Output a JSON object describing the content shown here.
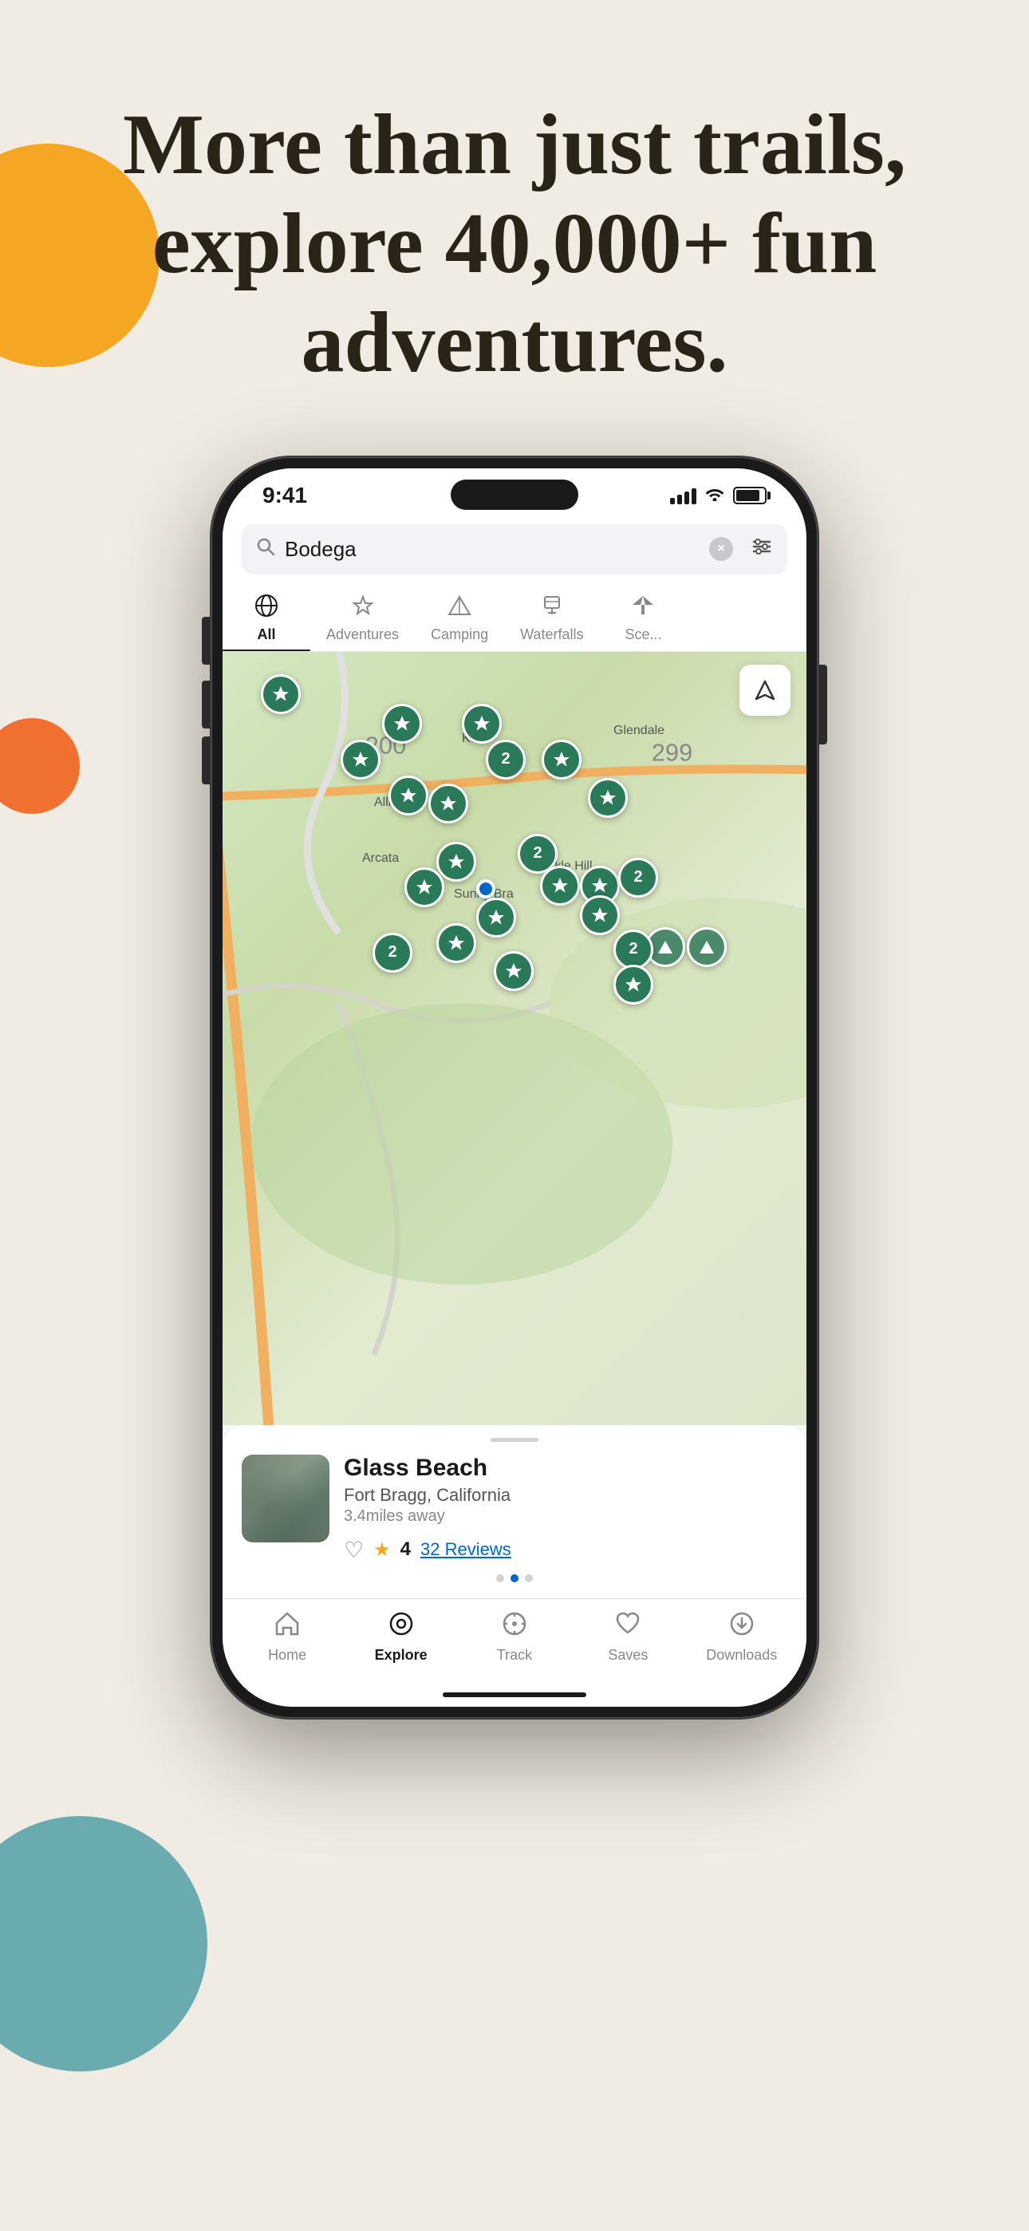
{
  "background": {
    "color": "#f0ece3"
  },
  "hero": {
    "title": "More than just trails, explore 40,000+ fun adventures."
  },
  "decorative": {
    "circle_orange": "#f5a623",
    "circle_orange_small": "#f07030",
    "circle_teal": "#6aabb0"
  },
  "phone": {
    "status_bar": {
      "time": "9:41",
      "signal_label": "signal",
      "wifi_label": "wifi",
      "battery_label": "battery"
    },
    "search": {
      "value": "Bodega",
      "placeholder": "Search",
      "clear_label": "×",
      "filter_label": "⚙"
    },
    "category_tabs": [
      {
        "id": "all",
        "label": "All",
        "icon": "🌍",
        "active": true
      },
      {
        "id": "adventures",
        "label": "Adventures",
        "icon": "✦",
        "active": false
      },
      {
        "id": "camping",
        "label": "Camping",
        "icon": "⛺",
        "active": false
      },
      {
        "id": "waterfalls",
        "label": "Waterfalls",
        "icon": "⛩",
        "active": false
      },
      {
        "id": "scenic",
        "label": "Scenic",
        "icon": "🌲",
        "active": false
      }
    ],
    "map": {
      "places": [
        "Korb",
        "Allia",
        "Arcata",
        "Glendale",
        "Sunny Bra",
        "Fickle Hill"
      ],
      "nav_button_label": "navigate",
      "user_dot_color": "#0066cc"
    },
    "location_card": {
      "title": "Glass Beach",
      "subtitle": "Fort Bragg, California",
      "distance": "3.4miles away",
      "rating": "4",
      "reviews": "32 Reviews",
      "reviews_count": "32",
      "pagination_dots": 3,
      "active_dot": 1
    },
    "tab_bar": [
      {
        "id": "home",
        "label": "Home",
        "icon": "⌂",
        "active": false
      },
      {
        "id": "explore",
        "label": "Explore",
        "icon": "◎",
        "active": true
      },
      {
        "id": "track",
        "label": "Track",
        "icon": "⊙",
        "active": false
      },
      {
        "id": "saves",
        "label": "Saves",
        "icon": "♡",
        "active": false
      },
      {
        "id": "downloads",
        "label": "Downloads",
        "icon": "⊙",
        "active": false
      }
    ]
  }
}
